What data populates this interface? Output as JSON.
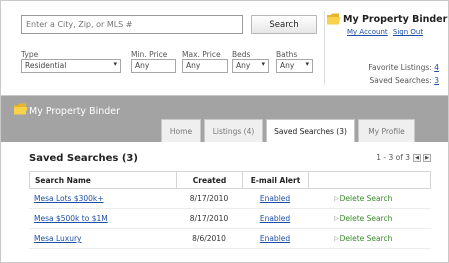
{
  "search": {
    "placeholder": "Enter a City, Zip, or MLS #",
    "button_label": "Search"
  },
  "filters": {
    "type_label": "Type",
    "type_value": "Residential",
    "min_price_label": "Min. Price",
    "min_price_value": "Any",
    "max_price_label": "Max. Price",
    "max_price_value": "Any",
    "beds_label": "Beds",
    "beds_value": "Any",
    "baths_label": "Baths",
    "baths_value": "Any"
  },
  "binder": {
    "title": "My Property Binder",
    "my_account": "My Account",
    "sign_out": "Sign Out",
    "favorite_listings_label": "Favorite Listings:",
    "favorite_listings_count": "4",
    "saved_searches_label": "Saved Searches:",
    "saved_searches_count": "3"
  },
  "panel": {
    "title": "My Property Binder",
    "tabs": [
      {
        "label": "Home"
      },
      {
        "label": "Listings (4)"
      },
      {
        "label": "Saved Searches (3)"
      },
      {
        "label": "My Profile"
      }
    ]
  },
  "saved": {
    "title": "Saved Searches (3)",
    "pager": "1 - 3 of 3",
    "columns": [
      "Search Name",
      "Created",
      "E-mail Alert"
    ],
    "rows": [
      {
        "name": "Mesa Lots $300k+",
        "created": "8/17/2010",
        "alert": "Enabled",
        "action": "Delete Search"
      },
      {
        "name": "Mesa $500k to $1M",
        "created": "8/17/2010",
        "alert": "Enabled",
        "action": "Delete Search"
      },
      {
        "name": "Mesa Luxury",
        "created": "8/6/2010",
        "alert": "Enabled",
        "action": "Delete Search"
      }
    ]
  },
  "colors": {
    "link": "#1d4fa8",
    "header_bar": "#a3a3a3",
    "delete_green": "#3a8a2a"
  },
  "icons": {
    "binder": "folder-icon",
    "pager_prev": "arrow-left-icon",
    "pager_next": "arrow-right-icon",
    "delete": "triangle-right-icon"
  }
}
